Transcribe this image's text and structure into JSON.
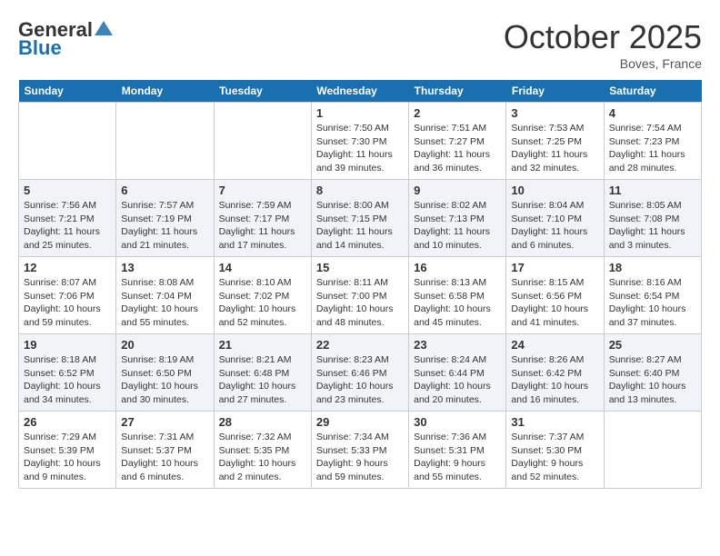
{
  "header": {
    "logo_general": "General",
    "logo_blue": "Blue",
    "month": "October 2025",
    "location": "Boves, France"
  },
  "weekdays": [
    "Sunday",
    "Monday",
    "Tuesday",
    "Wednesday",
    "Thursday",
    "Friday",
    "Saturday"
  ],
  "weeks": [
    [
      {
        "day": "",
        "detail": ""
      },
      {
        "day": "",
        "detail": ""
      },
      {
        "day": "",
        "detail": ""
      },
      {
        "day": "1",
        "detail": "Sunrise: 7:50 AM\nSunset: 7:30 PM\nDaylight: 11 hours and 39 minutes."
      },
      {
        "day": "2",
        "detail": "Sunrise: 7:51 AM\nSunset: 7:27 PM\nDaylight: 11 hours and 36 minutes."
      },
      {
        "day": "3",
        "detail": "Sunrise: 7:53 AM\nSunset: 7:25 PM\nDaylight: 11 hours and 32 minutes."
      },
      {
        "day": "4",
        "detail": "Sunrise: 7:54 AM\nSunset: 7:23 PM\nDaylight: 11 hours and 28 minutes."
      }
    ],
    [
      {
        "day": "5",
        "detail": "Sunrise: 7:56 AM\nSunset: 7:21 PM\nDaylight: 11 hours and 25 minutes."
      },
      {
        "day": "6",
        "detail": "Sunrise: 7:57 AM\nSunset: 7:19 PM\nDaylight: 11 hours and 21 minutes."
      },
      {
        "day": "7",
        "detail": "Sunrise: 7:59 AM\nSunset: 7:17 PM\nDaylight: 11 hours and 17 minutes."
      },
      {
        "day": "8",
        "detail": "Sunrise: 8:00 AM\nSunset: 7:15 PM\nDaylight: 11 hours and 14 minutes."
      },
      {
        "day": "9",
        "detail": "Sunrise: 8:02 AM\nSunset: 7:13 PM\nDaylight: 11 hours and 10 minutes."
      },
      {
        "day": "10",
        "detail": "Sunrise: 8:04 AM\nSunset: 7:10 PM\nDaylight: 11 hours and 6 minutes."
      },
      {
        "day": "11",
        "detail": "Sunrise: 8:05 AM\nSunset: 7:08 PM\nDaylight: 11 hours and 3 minutes."
      }
    ],
    [
      {
        "day": "12",
        "detail": "Sunrise: 8:07 AM\nSunset: 7:06 PM\nDaylight: 10 hours and 59 minutes."
      },
      {
        "day": "13",
        "detail": "Sunrise: 8:08 AM\nSunset: 7:04 PM\nDaylight: 10 hours and 55 minutes."
      },
      {
        "day": "14",
        "detail": "Sunrise: 8:10 AM\nSunset: 7:02 PM\nDaylight: 10 hours and 52 minutes."
      },
      {
        "day": "15",
        "detail": "Sunrise: 8:11 AM\nSunset: 7:00 PM\nDaylight: 10 hours and 48 minutes."
      },
      {
        "day": "16",
        "detail": "Sunrise: 8:13 AM\nSunset: 6:58 PM\nDaylight: 10 hours and 45 minutes."
      },
      {
        "day": "17",
        "detail": "Sunrise: 8:15 AM\nSunset: 6:56 PM\nDaylight: 10 hours and 41 minutes."
      },
      {
        "day": "18",
        "detail": "Sunrise: 8:16 AM\nSunset: 6:54 PM\nDaylight: 10 hours and 37 minutes."
      }
    ],
    [
      {
        "day": "19",
        "detail": "Sunrise: 8:18 AM\nSunset: 6:52 PM\nDaylight: 10 hours and 34 minutes."
      },
      {
        "day": "20",
        "detail": "Sunrise: 8:19 AM\nSunset: 6:50 PM\nDaylight: 10 hours and 30 minutes."
      },
      {
        "day": "21",
        "detail": "Sunrise: 8:21 AM\nSunset: 6:48 PM\nDaylight: 10 hours and 27 minutes."
      },
      {
        "day": "22",
        "detail": "Sunrise: 8:23 AM\nSunset: 6:46 PM\nDaylight: 10 hours and 23 minutes."
      },
      {
        "day": "23",
        "detail": "Sunrise: 8:24 AM\nSunset: 6:44 PM\nDaylight: 10 hours and 20 minutes."
      },
      {
        "day": "24",
        "detail": "Sunrise: 8:26 AM\nSunset: 6:42 PM\nDaylight: 10 hours and 16 minutes."
      },
      {
        "day": "25",
        "detail": "Sunrise: 8:27 AM\nSunset: 6:40 PM\nDaylight: 10 hours and 13 minutes."
      }
    ],
    [
      {
        "day": "26",
        "detail": "Sunrise: 7:29 AM\nSunset: 5:39 PM\nDaylight: 10 hours and 9 minutes."
      },
      {
        "day": "27",
        "detail": "Sunrise: 7:31 AM\nSunset: 5:37 PM\nDaylight: 10 hours and 6 minutes."
      },
      {
        "day": "28",
        "detail": "Sunrise: 7:32 AM\nSunset: 5:35 PM\nDaylight: 10 hours and 2 minutes."
      },
      {
        "day": "29",
        "detail": "Sunrise: 7:34 AM\nSunset: 5:33 PM\nDaylight: 9 hours and 59 minutes."
      },
      {
        "day": "30",
        "detail": "Sunrise: 7:36 AM\nSunset: 5:31 PM\nDaylight: 9 hours and 55 minutes."
      },
      {
        "day": "31",
        "detail": "Sunrise: 7:37 AM\nSunset: 5:30 PM\nDaylight: 9 hours and 52 minutes."
      },
      {
        "day": "",
        "detail": ""
      }
    ]
  ]
}
